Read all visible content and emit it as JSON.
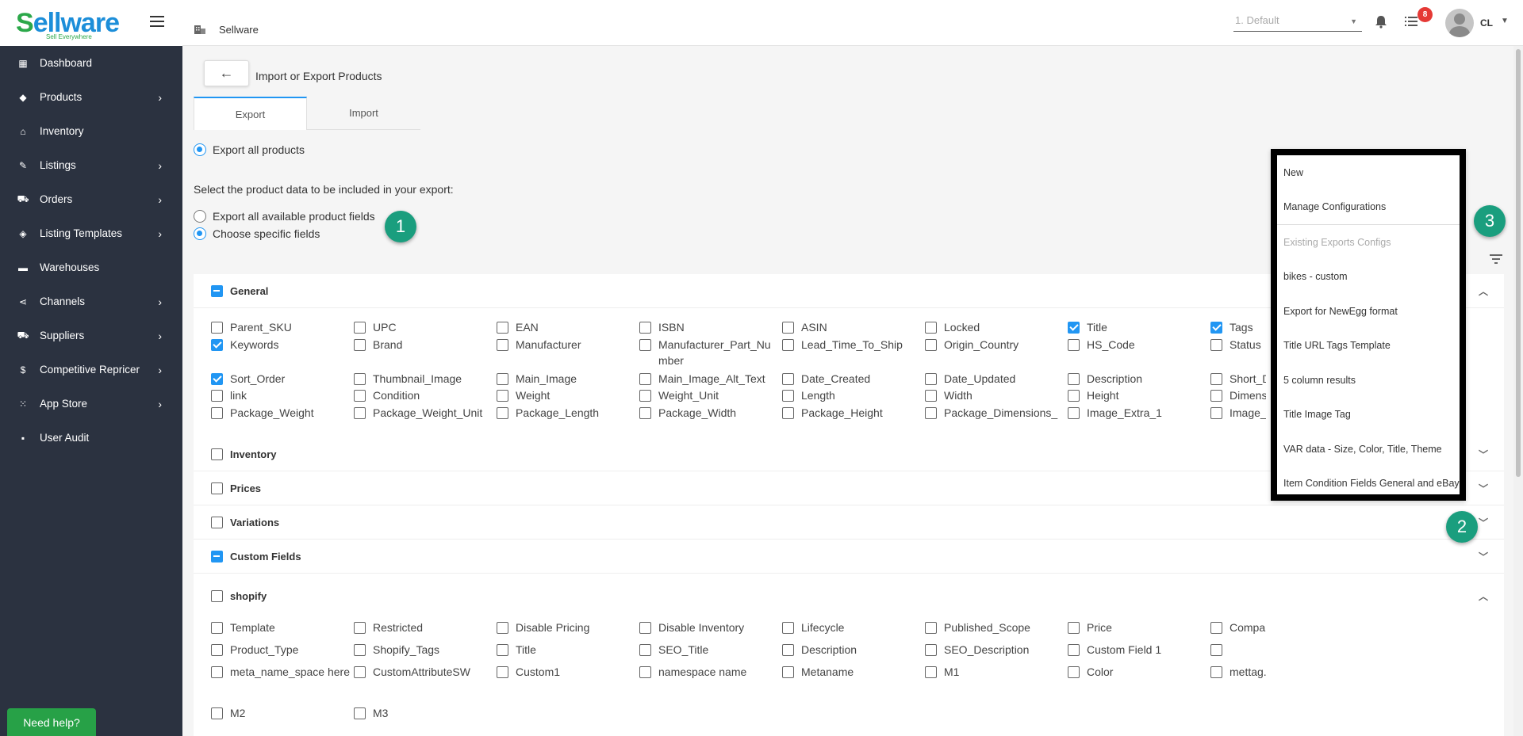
{
  "app": {
    "logo_main": "ellware",
    "logo_s": "S",
    "logo_tagline": "Sell Everywhere"
  },
  "sidebar": {
    "items": [
      {
        "label": "Dashboard",
        "icon": "dashboard-icon",
        "glyph": "▦",
        "chevron": false
      },
      {
        "label": "Products",
        "icon": "tag-icon",
        "glyph": "◆",
        "chevron": true
      },
      {
        "label": "Inventory",
        "icon": "bank-icon",
        "glyph": "⌂",
        "chevron": false
      },
      {
        "label": "Listings",
        "icon": "edit-icon",
        "glyph": "✎",
        "chevron": true
      },
      {
        "label": "Orders",
        "icon": "cart-icon",
        "glyph": "⛟",
        "chevron": true
      },
      {
        "label": "Listing Templates",
        "icon": "layers-icon",
        "glyph": "◈",
        "chevron": true
      },
      {
        "label": "Warehouses",
        "icon": "warehouse-icon",
        "glyph": "▬",
        "chevron": false
      },
      {
        "label": "Channels",
        "icon": "share-icon",
        "glyph": "⋖",
        "chevron": true
      },
      {
        "label": "Suppliers",
        "icon": "truck-icon",
        "glyph": "⛟",
        "chevron": true
      },
      {
        "label": "Competitive Repricer",
        "icon": "dollar-icon",
        "glyph": "$",
        "chevron": true
      },
      {
        "label": "App Store",
        "icon": "grid-icon",
        "glyph": "⁙",
        "chevron": true
      },
      {
        "label": "User Audit",
        "icon": "feedback-icon",
        "glyph": "▪",
        "chevron": false
      }
    ]
  },
  "topbar": {
    "breadcrumb": "Sellware",
    "profile_select": "1. Default",
    "notification_count": "8",
    "user_initials": "CL"
  },
  "page": {
    "title": "Import or Export Products",
    "tabs": [
      "Export",
      "Import"
    ],
    "export_all_products": "Export all products",
    "prompt": "Select the product data to be included in your export:",
    "option_all_fields": "Export all available product fields",
    "option_specific": "Choose specific fields"
  },
  "steps": [
    "1",
    "2",
    "3"
  ],
  "sections": {
    "general": "General",
    "inventory": "Inventory",
    "prices": "Prices",
    "variations": "Variations",
    "custom_fields": "Custom Fields",
    "shopify": "shopify"
  },
  "general_fields": [
    [
      {
        "label": "Parent_SKU",
        "checked": false
      },
      {
        "label": "UPC",
        "checked": false
      },
      {
        "label": "EAN",
        "checked": false
      },
      {
        "label": "ISBN",
        "checked": false
      },
      {
        "label": "ASIN",
        "checked": false
      },
      {
        "label": "Locked",
        "checked": false
      },
      {
        "label": "Title",
        "checked": true
      },
      {
        "label": "Tags",
        "checked": true
      }
    ],
    [
      {
        "label": "Keywords",
        "checked": true
      },
      {
        "label": "Brand",
        "checked": false
      },
      {
        "label": "Manufacturer",
        "checked": false
      },
      {
        "label": "Manufacturer_Part_Number",
        "checked": false
      },
      {
        "label": "Lead_Time_To_Ship",
        "checked": false
      },
      {
        "label": "Origin_Country",
        "checked": false
      },
      {
        "label": "HS_Code",
        "checked": false
      },
      {
        "label": "Status",
        "checked": false
      }
    ],
    [
      {
        "label": "Sort_Order",
        "checked": true
      },
      {
        "label": "Thumbnail_Image",
        "checked": false
      },
      {
        "label": "Main_Image",
        "checked": false
      },
      {
        "label": "Main_Image_Alt_Text",
        "checked": false
      },
      {
        "label": "Date_Created",
        "checked": false
      },
      {
        "label": "Date_Updated",
        "checked": false
      },
      {
        "label": "Description",
        "checked": false
      },
      {
        "label": "Short_De",
        "checked": false
      }
    ],
    [
      {
        "label": "link",
        "checked": false
      },
      {
        "label": "Condition",
        "checked": false
      },
      {
        "label": "Weight",
        "checked": false
      },
      {
        "label": "Weight_Unit",
        "checked": false
      },
      {
        "label": "Length",
        "checked": false
      },
      {
        "label": "Width",
        "checked": false
      },
      {
        "label": "Height",
        "checked": false
      },
      {
        "label": "Dimensio",
        "checked": false
      }
    ],
    [
      {
        "label": "Package_Weight",
        "checked": false
      },
      {
        "label": "Package_Weight_Unit",
        "checked": false
      },
      {
        "label": "Package_Length",
        "checked": false
      },
      {
        "label": "Package_Width",
        "checked": false
      },
      {
        "label": "Package_Height",
        "checked": false
      },
      {
        "label": "Package_Dimensions_",
        "checked": false
      },
      {
        "label": "Image_Extra_1",
        "checked": false
      },
      {
        "label": "Image_E",
        "checked": false
      }
    ]
  ],
  "shopify_fields": [
    [
      {
        "label": "Template",
        "checked": false
      },
      {
        "label": "Restricted",
        "checked": false
      },
      {
        "label": "Disable Pricing",
        "checked": false
      },
      {
        "label": "Disable Inventory",
        "checked": false
      },
      {
        "label": "Lifecycle",
        "checked": false
      },
      {
        "label": "Published_Scope",
        "checked": false
      },
      {
        "label": "Price",
        "checked": false
      },
      {
        "label": "Compare_At_Price",
        "checked": false
      }
    ],
    [
      {
        "label": "Product_Type",
        "checked": false
      },
      {
        "label": "Shopify_Tags",
        "checked": false
      },
      {
        "label": "Title",
        "checked": false
      },
      {
        "label": "SEO_Title",
        "checked": false
      },
      {
        "label": "Description",
        "checked": false
      },
      {
        "label": "SEO_Description",
        "checked": false
      },
      {
        "label": "Custom Field 1",
        "checked": false
      },
      {
        "label": "",
        "checked": false
      }
    ],
    [
      {
        "label": "meta_name_space here",
        "checked": false
      },
      {
        "label": "CustomAttributeSW",
        "checked": false
      },
      {
        "label": "Custom1",
        "checked": false
      },
      {
        "label": "namespace name",
        "checked": false
      },
      {
        "label": "Metaname",
        "checked": false
      },
      {
        "label": "M1",
        "checked": false
      },
      {
        "label": "Color",
        "checked": false
      },
      {
        "label": "mettag.parent",
        "checked": false
      }
    ],
    [
      {
        "label": "M2",
        "checked": false
      },
      {
        "label": "M3",
        "checked": false
      }
    ]
  ],
  "config_menu": [
    {
      "label": "New",
      "muted": false
    },
    {
      "label": "Manage Configurations",
      "muted": false
    },
    {
      "label": "Existing Exports Configs",
      "muted": true
    },
    {
      "label": "bikes - custom",
      "muted": false
    },
    {
      "label": "Export for NewEgg format",
      "muted": false
    },
    {
      "label": "Title URL Tags Template",
      "muted": false
    },
    {
      "label": "5 column results",
      "muted": false
    },
    {
      "label": "Title Image Tag",
      "muted": false
    },
    {
      "label": "VAR data - Size, Color, Title, Theme",
      "muted": false
    },
    {
      "label": "Item Condition Fields General and eBay",
      "muted": false
    }
  ],
  "help_button": "Need help?",
  "colors": {
    "sidebar_bg": "#2b3240",
    "accent": "#2196f3",
    "step_badge": "#1a9e7e",
    "help": "#27a147",
    "notification": "#e53935"
  }
}
